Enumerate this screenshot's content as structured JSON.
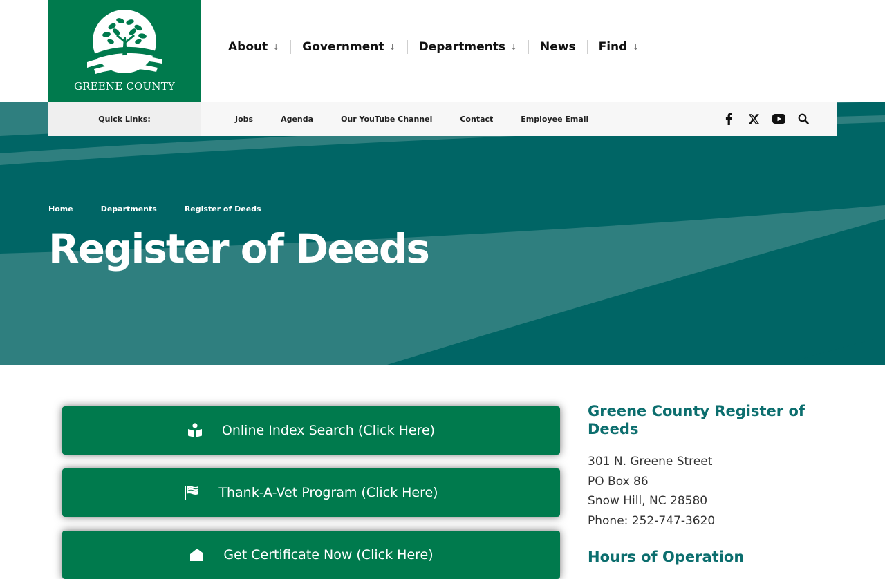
{
  "header": {
    "logo_text": "GREENE COUNTY",
    "nav": [
      {
        "label": "About",
        "arrow": "↓"
      },
      {
        "label": "Government",
        "arrow": "↓"
      },
      {
        "label": "Departments",
        "arrow": "↓"
      },
      {
        "label": "News",
        "arrow": ""
      },
      {
        "label": "Find",
        "arrow": "↓"
      }
    ]
  },
  "quick_links": {
    "label": "Quick Links:",
    "items": [
      "Jobs",
      "Agenda",
      "Our YouTube Channel",
      "Contact",
      "Employee Email"
    ],
    "social_icons": [
      "facebook-icon",
      "x-twitter-icon",
      "youtube-icon",
      "search-icon"
    ]
  },
  "breadcrumb": [
    "Home",
    "Departments",
    "Register of Deeds"
  ],
  "page_title": "Register of Deeds",
  "buttons": [
    {
      "label": "Online Index Search (Click Here)",
      "icon": "book-reader-icon"
    },
    {
      "label": "Thank-A-Vet Program (Click Here)",
      "icon": "flag-icon"
    },
    {
      "label": "Get Certificate Now (Click Here)",
      "icon": "certificate-icon"
    }
  ],
  "sidebar": {
    "title": "Greene County Register of Deeds",
    "address_lines": [
      "301 N. Greene Street",
      "PO Box 86",
      "Snow Hill, NC 28580",
      "Phone: 252-747-3620"
    ],
    "subheading": "Hours of Operation"
  },
  "colors": {
    "brand_green": "#007a4d",
    "hero_teal": "#2f7f7f",
    "hero_dark_teal": "#006565",
    "heading_teal": "#0c6e6e"
  }
}
